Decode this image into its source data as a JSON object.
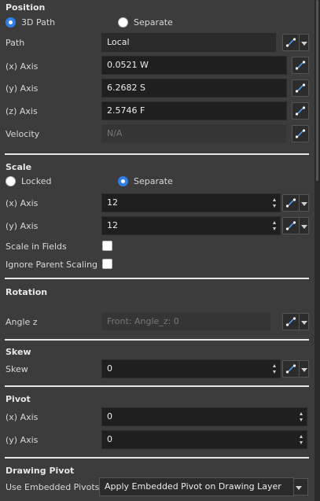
{
  "position": {
    "header": "Position",
    "mode_3d_path": "3D Path",
    "mode_separate": "Separate",
    "path_label": "Path",
    "path_value": "Local",
    "x_label": "(x) Axis",
    "x_value": "0.0521 W",
    "y_label": "(y) Axis",
    "y_value": "6.2682 S",
    "z_label": "(z) Axis",
    "z_value": "2.5746 F",
    "velocity_label": "Velocity",
    "velocity_value": "N/A"
  },
  "scale": {
    "header": "Scale",
    "locked": "Locked",
    "separate": "Separate",
    "x_label": "(x) Axis",
    "x_value": "12",
    "y_label": "(y) Axis",
    "y_value": "12",
    "in_fields_label": "Scale in Fields",
    "ignore_parent_label": "Ignore Parent Scaling"
  },
  "rotation": {
    "header": "Rotation",
    "angle_label": "Angle z",
    "angle_value": "Front: Angle_z: 0"
  },
  "skew": {
    "header": "Skew",
    "label": "Skew",
    "value": "0"
  },
  "pivot": {
    "header": "Pivot",
    "x_label": "(x) Axis",
    "x_value": "0",
    "y_label": "(y) Axis",
    "y_value": "0"
  },
  "drawing_pivot": {
    "header": "Drawing Pivot",
    "label": "Use Embedded Pivots",
    "value": "Apply Embedded Pivot on Drawing Layer"
  },
  "colors": {
    "accent": "#2f7fe6",
    "background": "#3c3c3c",
    "field": "#1f1f1f"
  },
  "icons": {
    "function_curve": "function-curve-icon",
    "dropdown": "chevron-down-icon"
  }
}
